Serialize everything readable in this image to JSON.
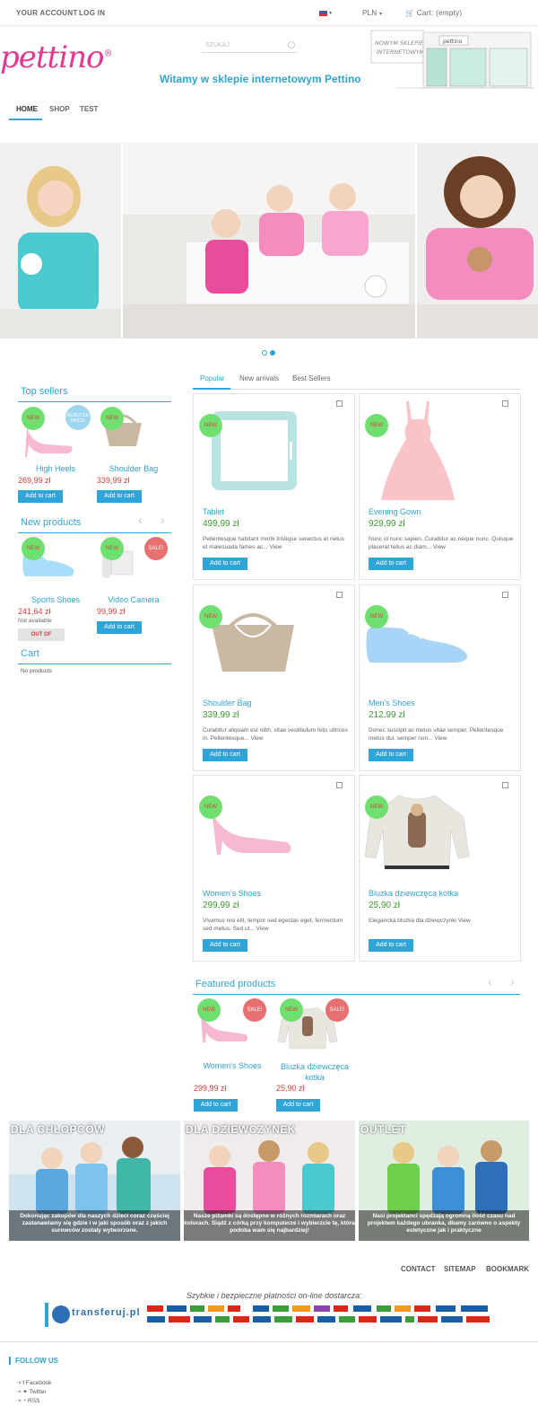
{
  "topbar": {
    "account": "YOUR ACCOUNT",
    "login": "LOG IN",
    "currency": "PLN",
    "cart": "Cart: (empty)"
  },
  "header": {
    "logo": "pettino",
    "search_placeholder": "SZUKAJ",
    "welcome": "Witamy w sklepie internetowym Pettino",
    "store_sign": "NOWYM SKLEPIE\nINTERNETOWYM",
    "store_brand": "pettino"
  },
  "nav": {
    "items": [
      "HOME",
      "SHOP",
      "TEST"
    ]
  },
  "sidebar": {
    "top_sellers": {
      "title": "Top sellers",
      "products": [
        {
          "name": "High Heels",
          "price": "269,99 zł",
          "badge": "NEW",
          "badge2": "REDUCED PRICE!",
          "button": "Add to cart"
        },
        {
          "name": "Shoulder Bag",
          "price": "339,99 zł",
          "badge": "NEW",
          "button": "Add to cart"
        }
      ]
    },
    "new_products": {
      "title": "New products",
      "products": [
        {
          "name": "Sports Shoes",
          "price": "241,64 zł",
          "note": "Not available",
          "badge": "NEW",
          "button": "OUT OF"
        },
        {
          "name": "Video Camera",
          "price": "99,99 zł",
          "badge": "NEW",
          "badge2": "SALE!",
          "button": "Add to cart"
        }
      ]
    },
    "cart": {
      "title": "Cart",
      "empty": "No products"
    }
  },
  "tabs": [
    "Popular",
    "New arrivals",
    "Best Sellers"
  ],
  "products": [
    {
      "name": "Tablet",
      "price": "499,99 zł",
      "desc": "Pellentesque habitant morbi tristique senectus et netus et malesuada fames ac...",
      "view": "View",
      "badge": "NEW",
      "button": "Add to cart"
    },
    {
      "name": "Evening Gown",
      "price": "929,99 zł",
      "desc": "Nunc id nunc sapien. Curabitur ac neque nunc. Quisque placerat tellus ac diam...",
      "view": "View",
      "badge": "NEW",
      "button": "Add to cart"
    },
    {
      "name": "Shoulder Bag",
      "price": "339,99 zł",
      "desc": "Curabitur aliquam est nibh, vitae vestibulum felis ultrices in. Pellentesque...",
      "view": "View",
      "badge": "NEW",
      "button": "Add to cart"
    },
    {
      "name": "Men's Shoes",
      "price": "212,99 zł",
      "desc": "Donec suscipit ac metus vitae semper. Pellentesque metus dui, semper non...",
      "view": "View",
      "badge": "NEW",
      "button": "Add to cart"
    },
    {
      "name": "Women's Shoes",
      "price": "299,99 zł",
      "desc": "Vivamus nisi elit, tempor sed egestas eget, fermentum sed metus. Sed ut...",
      "view": "View",
      "badge": "NEW",
      "button": "Add to cart"
    },
    {
      "name": "Bluzka dziewczęca kotka",
      "price": "25,90 zł",
      "desc": "Elegancka bluzka dla dziewczynki",
      "view": "View",
      "badge": "NEW",
      "button": "Add to cart"
    }
  ],
  "featured": {
    "title": "Featured products",
    "products": [
      {
        "name": "Women's Shoes",
        "price": "299,99 zł",
        "badge": "NEW",
        "badge2": "SALE!",
        "button": "Add to cart"
      },
      {
        "name": "Bluzka dziewczęca kotka",
        "price": "25,90 zł",
        "badge": "NEW",
        "badge2": "SALE!",
        "button": "Add to cart"
      }
    ]
  },
  "promos": [
    {
      "title": "DLA CHŁOPCÓW",
      "caption": "Dokonując zakupów dla naszych dzieci coraz częściej zastanawiamy się gdzie i w jaki sposób oraz z jakich surowców zostały wytworzone."
    },
    {
      "title": "DLA DZIEWCZYNEK",
      "caption": "Nasze piżamki są dostępne w różnych rozmiarach oraz kolorach. Siądź z córką przy komputerze i wybierzcie tę, która podoba wam się najbardziej!"
    },
    {
      "title": "OUTLET",
      "caption": "Nasi projektanci spędzają ogromną ilość czasu nad projektem każdego ubranka, dbamy zarówno o aspekty estetyczne jak i praktyczne"
    }
  ],
  "footer": {
    "links": [
      "CONTACT",
      "SITEMAP",
      "BOOKMARK"
    ],
    "payment_text": "Szybkie i bezpieczne płatności on-line dostarcza:",
    "payment_brand": "transferuj.pl",
    "follow": "FOLLOW US",
    "social": [
      "Facebook",
      "Twitter",
      "RSS"
    ]
  },
  "colors": {
    "accent": "#2fa4d6",
    "brand_pink": "#e4378f",
    "price_red": "#e03b3b",
    "price_green": "#3c9a2e",
    "badge_new": "#6fe06f",
    "badge_sale": "#e87070"
  }
}
